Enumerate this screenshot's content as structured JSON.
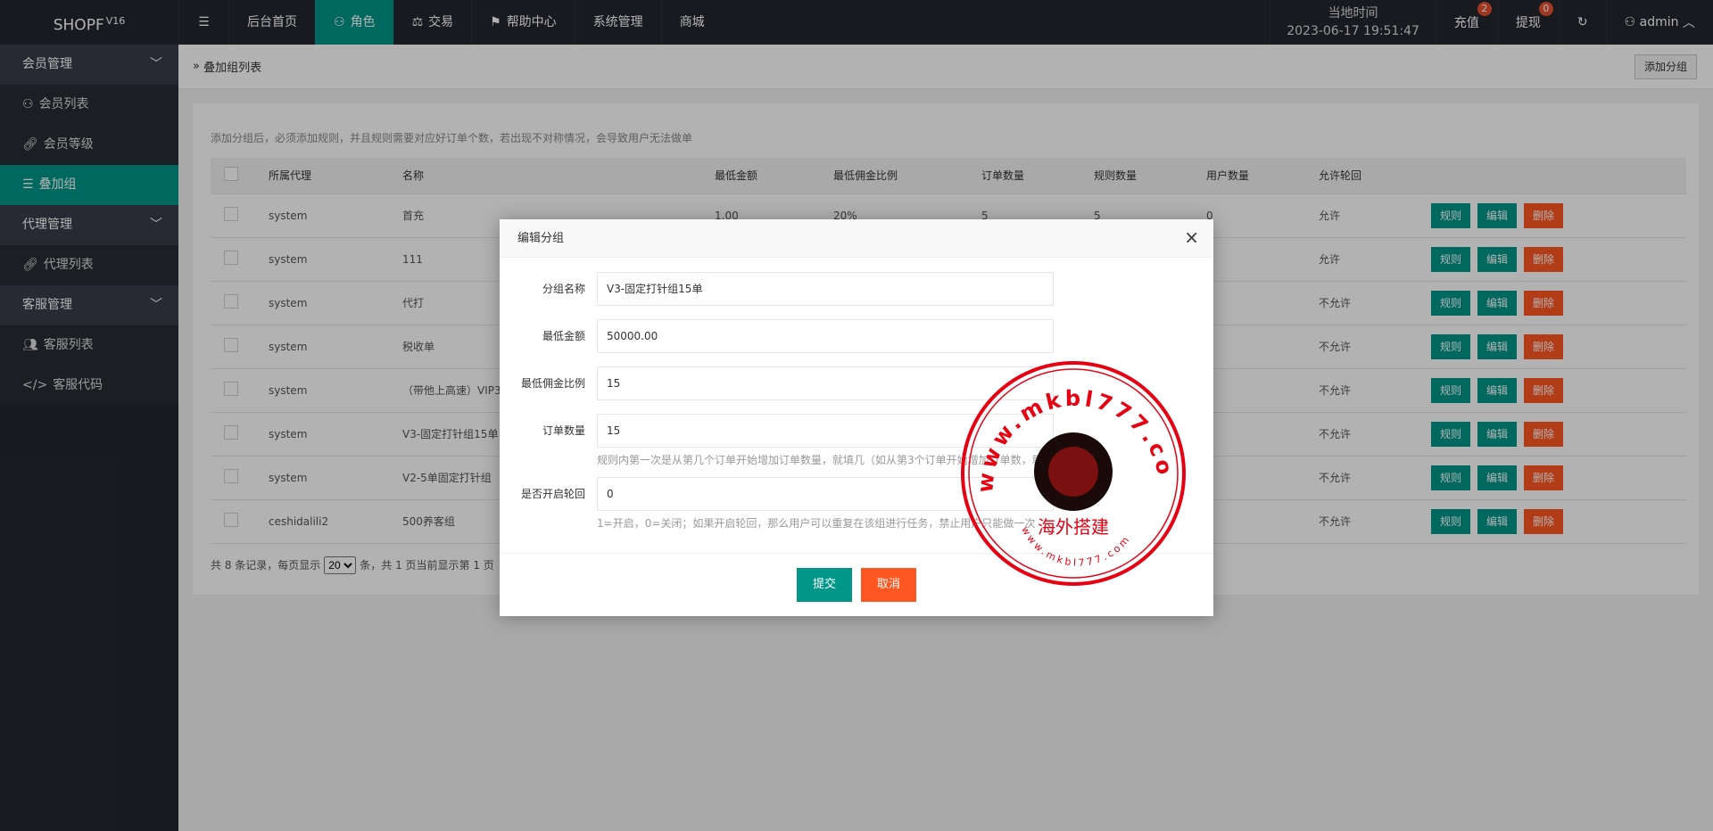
{
  "header": {
    "logo": "SHOPF",
    "logo_version": "V16",
    "nav": [
      {
        "label": "后台首页"
      },
      {
        "label": "角色"
      },
      {
        "label": "交易"
      },
      {
        "label": "帮助中心"
      },
      {
        "label": "系统管理"
      },
      {
        "label": "商城"
      }
    ],
    "time_label": "当地时间",
    "time_value": "2023-06-17 19:51:47",
    "recharge": "充值",
    "recharge_badge": "2",
    "withdraw": "提现",
    "withdraw_badge": "0",
    "user": "admin"
  },
  "sidebar": {
    "groups": [
      {
        "label": "会员管理",
        "items": [
          "会员列表",
          "会员等级",
          "叠加组"
        ]
      },
      {
        "label": "代理管理",
        "items": [
          "代理列表"
        ]
      },
      {
        "label": "客服管理",
        "items": [
          "客服列表",
          "客服代码"
        ]
      }
    ]
  },
  "breadcrumb": "叠加组列表",
  "add_button": "添加分组",
  "notice": "添加分组后，必须添加规则，并且规则需要对应好订单个数，若出现不对称情况，会导致用户无法做单",
  "table": {
    "headers": [
      "所属代理",
      "名称",
      "最低金额",
      "最低佣金比例",
      "订单数量",
      "规则数量",
      "用户数量",
      "允许轮回"
    ],
    "rows": [
      {
        "agent": "system",
        "name": "首充",
        "min": "1.00",
        "rate": "20%",
        "orders": "5",
        "rules": "5",
        "users": "0",
        "loop": "允许"
      },
      {
        "agent": "system",
        "name": "111",
        "loop": "允许"
      },
      {
        "agent": "system",
        "name": "代打",
        "loop": "不允许"
      },
      {
        "agent": "system",
        "name": "税收单",
        "loop": "不允许"
      },
      {
        "agent": "system",
        "name": "（带他上高速）VIP3",
        "loop": "不允许"
      },
      {
        "agent": "system",
        "name": "V3-固定打针组15单",
        "loop": "不允许"
      },
      {
        "agent": "system",
        "name": "V2-5单固定打针组",
        "loop": "不允许"
      },
      {
        "agent": "ceshidalili2",
        "name": "500养客组",
        "loop": "不允许"
      }
    ],
    "actions": {
      "rule": "规则",
      "edit": "编辑",
      "delete": "删除"
    }
  },
  "pager": {
    "prefix": "共 8 条记录，每页显示",
    "per_page": "20",
    "suffix": "条，共 1 页当前显示第 1 页"
  },
  "modal": {
    "title": "编辑分组",
    "close": "×",
    "fields": [
      {
        "label": "分组名称",
        "value": "V3-固定打针组15单"
      },
      {
        "label": "最低金额",
        "value": "50000.00"
      },
      {
        "label": "最低佣金比例",
        "value": "15"
      },
      {
        "label": "订单数量",
        "value": "15"
      },
      {
        "label": "是否开启轮回",
        "value": "0"
      }
    ],
    "hint_orders": "规则内第一次是从第几个订单开始增加订单数量，就填几（如从第3个订单开始增加订单数，就填",
    "hint_loop": "1=开启，0=关闭；如果开启轮回，那么用户可以重复在该组进行任务，禁止用户只能做一次",
    "submit": "提交",
    "cancel": "取消"
  },
  "stamp": {
    "url_top": "www.mkbl777.com",
    "name": "海外搭建",
    "url_bottom": "www.mkbl777.com",
    "color": "#e60012"
  }
}
